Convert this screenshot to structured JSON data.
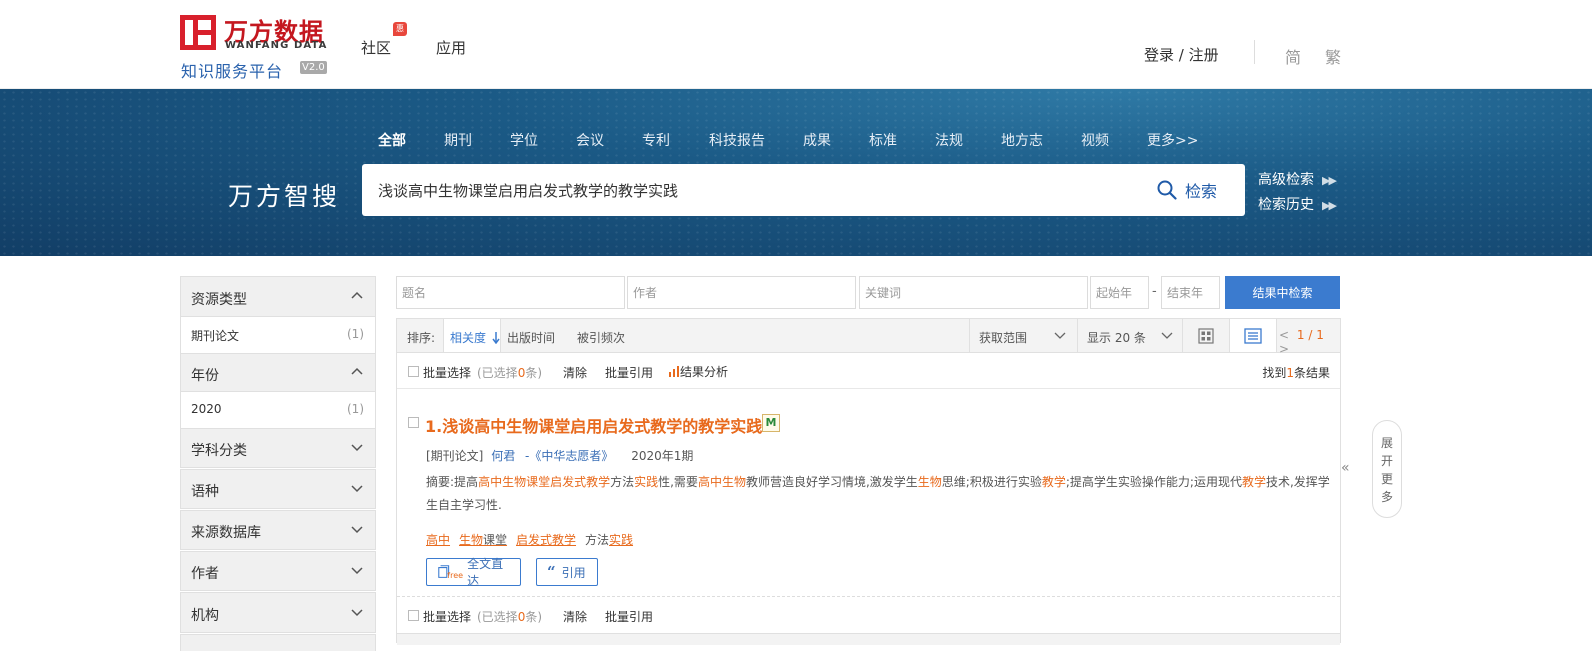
{
  "header": {
    "logo_cn": "万方数据",
    "logo_en": "WANFANG DATA",
    "platform": "知识服务平台",
    "version": "V2.0",
    "nav": [
      {
        "label": "社区",
        "badge": "惠"
      },
      {
        "label": "应用"
      }
    ],
    "login": "登录 / 注册",
    "lang_simplified": "简",
    "lang_traditional": "繁"
  },
  "banner": {
    "tabs": [
      "全部",
      "期刊",
      "学位",
      "会议",
      "专利",
      "科技报告",
      "成果",
      "标准",
      "法规",
      "地方志",
      "视频",
      "更多>>"
    ],
    "active_tab": "全部",
    "title": "万方智搜",
    "query": "浅谈高中生物课堂启用启发式教学的教学实践",
    "search_label": "检索",
    "advanced": "高级检索",
    "history": "检索历史"
  },
  "sidebar": {
    "resource_type": {
      "title": "资源类型",
      "items": [
        {
          "name": "期刊论文",
          "count": "(1)"
        }
      ]
    },
    "year": {
      "title": "年份",
      "items": [
        {
          "name": "2020",
          "count": "(1)"
        }
      ]
    },
    "collapsed": [
      "学科分类",
      "语种",
      "来源数据库",
      "作者",
      "机构"
    ]
  },
  "filters": {
    "title_ph": "题名",
    "author_ph": "作者",
    "keyword_ph": "关键词",
    "start_year_ph": "起始年",
    "dash": "-",
    "end_year_ph": "结束年",
    "search_in": "结果中检索"
  },
  "sortbar": {
    "label": "排序:",
    "relevance": "相关度",
    "pub_time": "出版时间",
    "cited": "被引频次",
    "range": "获取范围",
    "display": "显示 20 条",
    "page_prev": "<",
    "page": "1 / 1",
    "page_next": ">"
  },
  "batch": {
    "select": "批量选择",
    "selected_pre": "(已选择",
    "selected_count": "0",
    "selected_post": "条)",
    "clear": "清除",
    "cite": "批量引用",
    "analysis": "结果分析",
    "found_pre": "找到",
    "found_count": "1",
    "found_post": "条结果"
  },
  "result": {
    "index": "1.",
    "title": "浅谈高中生物课堂启用启发式教学的教学实践",
    "badge": "M",
    "type": "[期刊论文]",
    "author": "何君",
    "journal": "-《中华志愿者》",
    "issue": "2020年1期",
    "abstract_label": "摘要:",
    "abstract_parts": [
      {
        "t": "提高",
        "h": false
      },
      {
        "t": "高中生物课堂启发式教学",
        "h": true
      },
      {
        "t": "方法",
        "h": false
      },
      {
        "t": "实践",
        "h": true
      },
      {
        "t": "性,需要",
        "h": false
      },
      {
        "t": "高中生物",
        "h": true
      },
      {
        "t": "教师营造良好学习情境,激发学生",
        "h": false
      },
      {
        "t": "生物",
        "h": true
      },
      {
        "t": "思维;积极进行实验",
        "h": false
      },
      {
        "t": "教学",
        "h": true
      },
      {
        "t": ";提高学生实验操作能力;运用现代",
        "h": false
      },
      {
        "t": "教学",
        "h": true
      },
      {
        "t": "技术,发挥学生自主学习性.",
        "h": false
      }
    ],
    "keywords": {
      "k1": "高中",
      "k2a": "生物",
      "k2b": "课堂",
      "k3": "启发式教学",
      "k4a": "方法",
      "k4b": "实践"
    },
    "fulltext": "全文直达",
    "fulltext_tag": "free",
    "cite": "引用"
  },
  "expand": {
    "label": [
      "展",
      "开",
      "更",
      "多"
    ]
  },
  "colors": {
    "accent": "#3b7bcf",
    "highlight": "#e86a1d",
    "brand": "#c4171f"
  }
}
